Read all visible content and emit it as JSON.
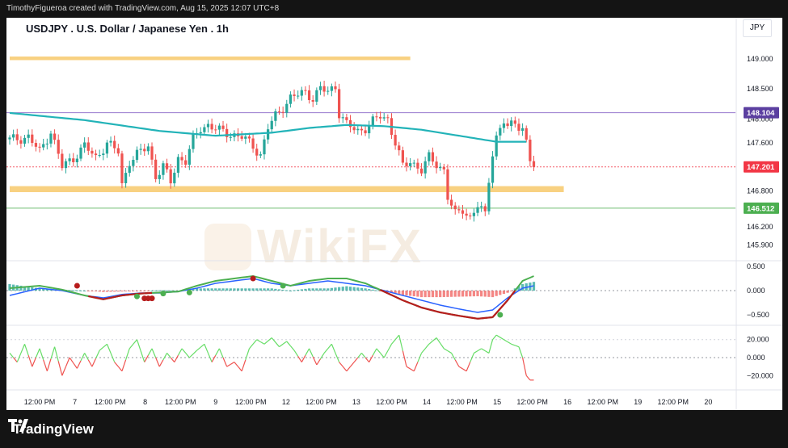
{
  "header": {
    "attribution": "TimothyFigueroa created with TradingView.com, Aug 15, 2025 12:07 UTC+8"
  },
  "chart_header": {
    "title": "USDJPY . U.S. Dollar / Japanese Yen . 1h",
    "currency": "JPY"
  },
  "footer": {
    "brand": "TradingView"
  },
  "watermark": {
    "text": "WikiFX"
  },
  "colors": {
    "up": "#26a69a",
    "down": "#ef5350",
    "ma": "#22b3b8",
    "zone": "#f7c96b",
    "macd_signal": "#4caf50",
    "macd_main": "#2962ff",
    "macd_down": "#b71c1c",
    "rsi_up": "#66dd66",
    "rsi_down": "#ef5350",
    "price_badge": "#f23645",
    "resistance_badge": "#5b3fa0",
    "support_badge": "#4caf50"
  },
  "chart_data": [
    {
      "type": "candlestick",
      "title": "USDJPY . U.S. Dollar / Japanese Yen . 1h",
      "ylim": [
        145.65,
        149.35
      ],
      "y_ticks": [
        149.0,
        148.5,
        148.0,
        147.6,
        146.8,
        146.2,
        145.9
      ],
      "y_tick_labels": [
        "149.000",
        "148.500",
        "148.000",
        "147.600",
        "146.800",
        "146.200",
        "145.900"
      ],
      "x_tick_labels": [
        "12:00 PM",
        "7",
        "12:00 PM",
        "8",
        "12:00 PM",
        "9",
        "12:00 PM",
        "12",
        "12:00 PM",
        "13",
        "12:00 PM",
        "14",
        "12:00 PM",
        "15",
        "12:00 PM",
        "16",
        "12:00 PM",
        "19",
        "12:00 PM",
        "20"
      ],
      "x_tick_index": [
        8,
        17.4,
        26.8,
        36.2,
        45.6,
        55,
        64.4,
        73.8,
        83.2,
        92.6,
        102,
        111.4,
        120.8,
        130.2,
        139.6,
        149,
        158.4,
        167.8,
        177.2,
        186.6
      ],
      "last_index": 140,
      "close_anchors": [
        [
          0,
          147.65
        ],
        [
          5,
          147.7
        ],
        [
          8,
          147.45
        ],
        [
          11,
          147.8
        ],
        [
          14,
          147.2
        ],
        [
          17,
          147.35
        ],
        [
          20,
          147.55
        ],
        [
          23,
          147.35
        ],
        [
          26,
          147.6
        ],
        [
          29,
          147.45
        ],
        [
          30,
          146.9
        ],
        [
          32,
          147.3
        ],
        [
          35,
          147.45
        ],
        [
          37,
          147.55
        ],
        [
          39,
          147.05
        ],
        [
          41,
          147.2
        ],
        [
          43,
          146.95
        ],
        [
          45,
          147.35
        ],
        [
          47,
          147.3
        ],
        [
          49,
          147.65
        ],
        [
          51,
          147.85
        ],
        [
          53,
          147.9
        ],
        [
          56,
          147.8
        ],
        [
          59,
          147.75
        ],
        [
          62,
          147.7
        ],
        [
          65,
          147.55
        ],
        [
          67,
          147.4
        ],
        [
          69,
          147.85
        ],
        [
          71,
          148.05
        ],
        [
          73,
          148.2
        ],
        [
          75,
          148.35
        ],
        [
          77,
          148.4
        ],
        [
          79,
          148.45
        ],
        [
          81,
          148.35
        ],
        [
          83,
          148.5
        ],
        [
          85,
          148.45
        ],
        [
          87,
          148.55
        ],
        [
          88,
          148.1
        ],
        [
          90,
          147.9
        ],
        [
          93,
          147.8
        ],
        [
          95,
          147.85
        ],
        [
          97,
          147.95
        ],
        [
          99,
          148.05
        ],
        [
          101,
          148.0
        ],
        [
          103,
          147.6
        ],
        [
          105,
          147.2
        ],
        [
          107,
          147.3
        ],
        [
          110,
          147.15
        ],
        [
          112,
          147.35
        ],
        [
          114,
          147.25
        ],
        [
          116,
          147.15
        ],
        [
          117,
          146.7
        ],
        [
          119,
          146.4
        ],
        [
          121,
          146.5
        ],
        [
          123,
          146.35
        ],
        [
          125,
          146.55
        ],
        [
          127,
          146.4
        ],
        [
          128,
          147.0
        ],
        [
          129,
          147.45
        ],
        [
          130,
          147.7
        ],
        [
          132,
          147.95
        ],
        [
          133,
          147.85
        ],
        [
          135,
          147.95
        ],
        [
          137,
          147.85
        ],
        [
          138,
          147.6
        ],
        [
          139,
          147.3
        ],
        [
          140,
          147.2
        ]
      ],
      "moving_average_anchors": [
        [
          0,
          148.1
        ],
        [
          20,
          147.98
        ],
        [
          40,
          147.8
        ],
        [
          55,
          147.72
        ],
        [
          70,
          147.77
        ],
        [
          80,
          147.85
        ],
        [
          90,
          147.9
        ],
        [
          100,
          147.88
        ],
        [
          110,
          147.82
        ],
        [
          120,
          147.72
        ],
        [
          130,
          147.62
        ],
        [
          138,
          147.62
        ]
      ],
      "zones": [
        {
          "from_index": 0,
          "to_index": 107,
          "y0": 149.04,
          "y1": 148.98
        },
        {
          "from_index": 0,
          "to_index": 148,
          "y0": 146.88,
          "y1": 146.78
        }
      ],
      "lines": [
        {
          "name": "resistance",
          "value": 148.104,
          "color": "#7e57c2"
        },
        {
          "name": "support",
          "value": 146.512,
          "color": "#4caf50"
        },
        {
          "name": "last",
          "value": 147.201,
          "color": "#f23645",
          "dashed": true
        }
      ],
      "badges": [
        "148.104",
        "147.201",
        "146.512"
      ]
    },
    {
      "type": "macd",
      "ylim": [
        -0.7,
        0.6
      ],
      "y_ticks": [
        0.5,
        0.0,
        -0.5
      ],
      "y_tick_labels": [
        "0.500",
        "0.000",
        "−0.500"
      ],
      "main_anchors": [
        [
          0,
          -0.1
        ],
        [
          8,
          0.05
        ],
        [
          14,
          0.0
        ],
        [
          20,
          -0.1
        ],
        [
          25,
          -0.15
        ],
        [
          30,
          -0.08
        ],
        [
          35,
          -0.05
        ],
        [
          40,
          -0.05
        ],
        [
          45,
          -0.02
        ],
        [
          50,
          0.05
        ],
        [
          55,
          0.15
        ],
        [
          60,
          0.2
        ],
        [
          65,
          0.25
        ],
        [
          70,
          0.15
        ],
        [
          75,
          0.1
        ],
        [
          80,
          0.15
        ],
        [
          85,
          0.2
        ],
        [
          90,
          0.15
        ],
        [
          95,
          0.1
        ],
        [
          100,
          0.0
        ],
        [
          105,
          -0.1
        ],
        [
          110,
          -0.2
        ],
        [
          115,
          -0.3
        ],
        [
          120,
          -0.38
        ],
        [
          125,
          -0.45
        ],
        [
          129,
          -0.4
        ],
        [
          133,
          -0.15
        ],
        [
          137,
          0.05
        ],
        [
          140,
          0.1
        ]
      ],
      "signal_anchors": [
        [
          0,
          0.05
        ],
        [
          8,
          0.1
        ],
        [
          14,
          0.02
        ],
        [
          20,
          -0.1
        ],
        [
          25,
          -0.18
        ],
        [
          30,
          -0.1
        ],
        [
          35,
          -0.06
        ],
        [
          40,
          -0.04
        ],
        [
          45,
          -0.02
        ],
        [
          50,
          0.1
        ],
        [
          55,
          0.2
        ],
        [
          60,
          0.25
        ],
        [
          65,
          0.3
        ],
        [
          70,
          0.2
        ],
        [
          75,
          0.1
        ],
        [
          80,
          0.2
        ],
        [
          85,
          0.25
        ],
        [
          90,
          0.25
        ],
        [
          95,
          0.15
        ],
        [
          100,
          -0.02
        ],
        [
          105,
          -0.2
        ],
        [
          110,
          -0.35
        ],
        [
          115,
          -0.45
        ],
        [
          120,
          -0.52
        ],
        [
          125,
          -0.58
        ],
        [
          129,
          -0.55
        ],
        [
          133,
          -0.2
        ],
        [
          137,
          0.2
        ],
        [
          140,
          0.3
        ]
      ],
      "dots_index": [
        18,
        34,
        36,
        37,
        38,
        41,
        48,
        65,
        73,
        131
      ],
      "dots_value": [
        0.1,
        -0.12,
        -0.16,
        -0.16,
        -0.16,
        -0.06,
        -0.04,
        0.25,
        0.1,
        -0.5
      ],
      "dot_colors": [
        "#b71c1c",
        "#4caf50",
        "#b71c1c",
        "#b71c1c",
        "#b71c1c",
        "#4caf50",
        "#4caf50",
        "#b71c1c",
        "#4caf50",
        "#4caf50"
      ]
    },
    {
      "type": "line",
      "ylim": [
        -35,
        35
      ],
      "y_ticks": [
        20,
        0,
        -20
      ],
      "y_tick_labels": [
        "20.000",
        "0.000",
        "−20.000"
      ],
      "value_anchors": [
        [
          0,
          5
        ],
        [
          2,
          -5
        ],
        [
          4,
          15
        ],
        [
          6,
          -10
        ],
        [
          8,
          10
        ],
        [
          10,
          -15
        ],
        [
          12,
          12
        ],
        [
          14,
          -20
        ],
        [
          16,
          0
        ],
        [
          18,
          -12
        ],
        [
          20,
          5
        ],
        [
          22,
          -10
        ],
        [
          24,
          8
        ],
        [
          26,
          15
        ],
        [
          28,
          -5
        ],
        [
          30,
          -15
        ],
        [
          32,
          10
        ],
        [
          34,
          20
        ],
        [
          36,
          -5
        ],
        [
          38,
          10
        ],
        [
          40,
          -10
        ],
        [
          42,
          5
        ],
        [
          44,
          -5
        ],
        [
          46,
          10
        ],
        [
          48,
          0
        ],
        [
          50,
          8
        ],
        [
          52,
          15
        ],
        [
          54,
          -5
        ],
        [
          56,
          10
        ],
        [
          58,
          -10
        ],
        [
          60,
          -5
        ],
        [
          62,
          -15
        ],
        [
          64,
          10
        ],
        [
          66,
          20
        ],
        [
          68,
          15
        ],
        [
          70,
          22
        ],
        [
          72,
          12
        ],
        [
          74,
          18
        ],
        [
          76,
          8
        ],
        [
          78,
          -5
        ],
        [
          80,
          10
        ],
        [
          82,
          -8
        ],
        [
          84,
          5
        ],
        [
          86,
          15
        ],
        [
          88,
          -5
        ],
        [
          90,
          -15
        ],
        [
          92,
          -5
        ],
        [
          94,
          5
        ],
        [
          96,
          -5
        ],
        [
          98,
          10
        ],
        [
          100,
          0
        ],
        [
          102,
          15
        ],
        [
          104,
          25
        ],
        [
          106,
          -10
        ],
        [
          108,
          -15
        ],
        [
          110,
          5
        ],
        [
          112,
          15
        ],
        [
          114,
          22
        ],
        [
          116,
          10
        ],
        [
          118,
          5
        ],
        [
          120,
          -10
        ],
        [
          122,
          -15
        ],
        [
          124,
          5
        ],
        [
          126,
          10
        ],
        [
          128,
          5
        ],
        [
          129,
          20
        ],
        [
          130,
          25
        ],
        [
          132,
          20
        ],
        [
          134,
          15
        ],
        [
          136,
          12
        ],
        [
          137,
          0
        ],
        [
          138,
          -20
        ],
        [
          139,
          -25
        ],
        [
          140,
          -25
        ]
      ]
    }
  ]
}
